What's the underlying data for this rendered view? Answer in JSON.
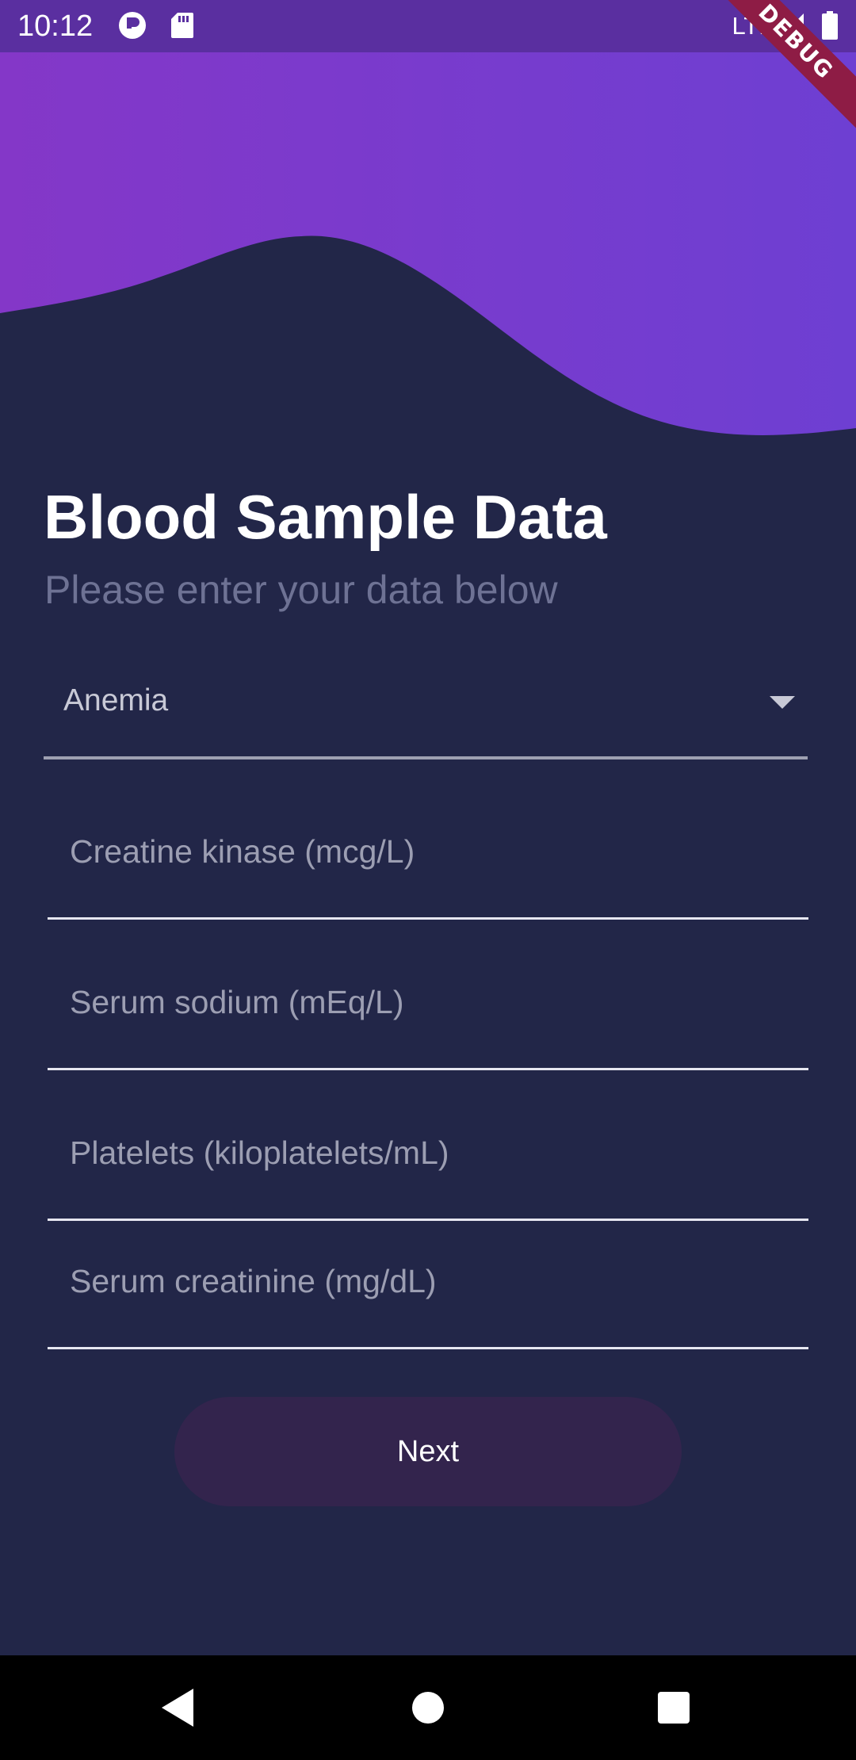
{
  "status_bar": {
    "time": "10:12",
    "network": "LTE",
    "debug_banner": "DEBUG",
    "icons": [
      "app-notification-icon",
      "sd-card-icon",
      "signal-icon",
      "battery-icon"
    ]
  },
  "colors": {
    "background": "#222648",
    "header_gradient_start": "#8437c8",
    "header_gradient_end": "#6e3fd2",
    "button_bg": "#33244d",
    "subtitle": "#6e7294"
  },
  "form": {
    "title": "Blood Sample Data",
    "subtitle": "Please enter your data below",
    "dropdown": {
      "selected": "Anemia"
    },
    "fields": [
      {
        "placeholder": "Creatine kinase (mcg/L)"
      },
      {
        "placeholder": "Serum sodium (mEq/L)"
      },
      {
        "placeholder": "Platelets (kiloplatelets/mL)"
      },
      {
        "placeholder": "Serum creatinine (mg/dL)"
      }
    ],
    "next_label": "Next"
  },
  "nav_bar": {
    "icons": [
      "back-icon",
      "home-icon",
      "recents-icon"
    ]
  }
}
